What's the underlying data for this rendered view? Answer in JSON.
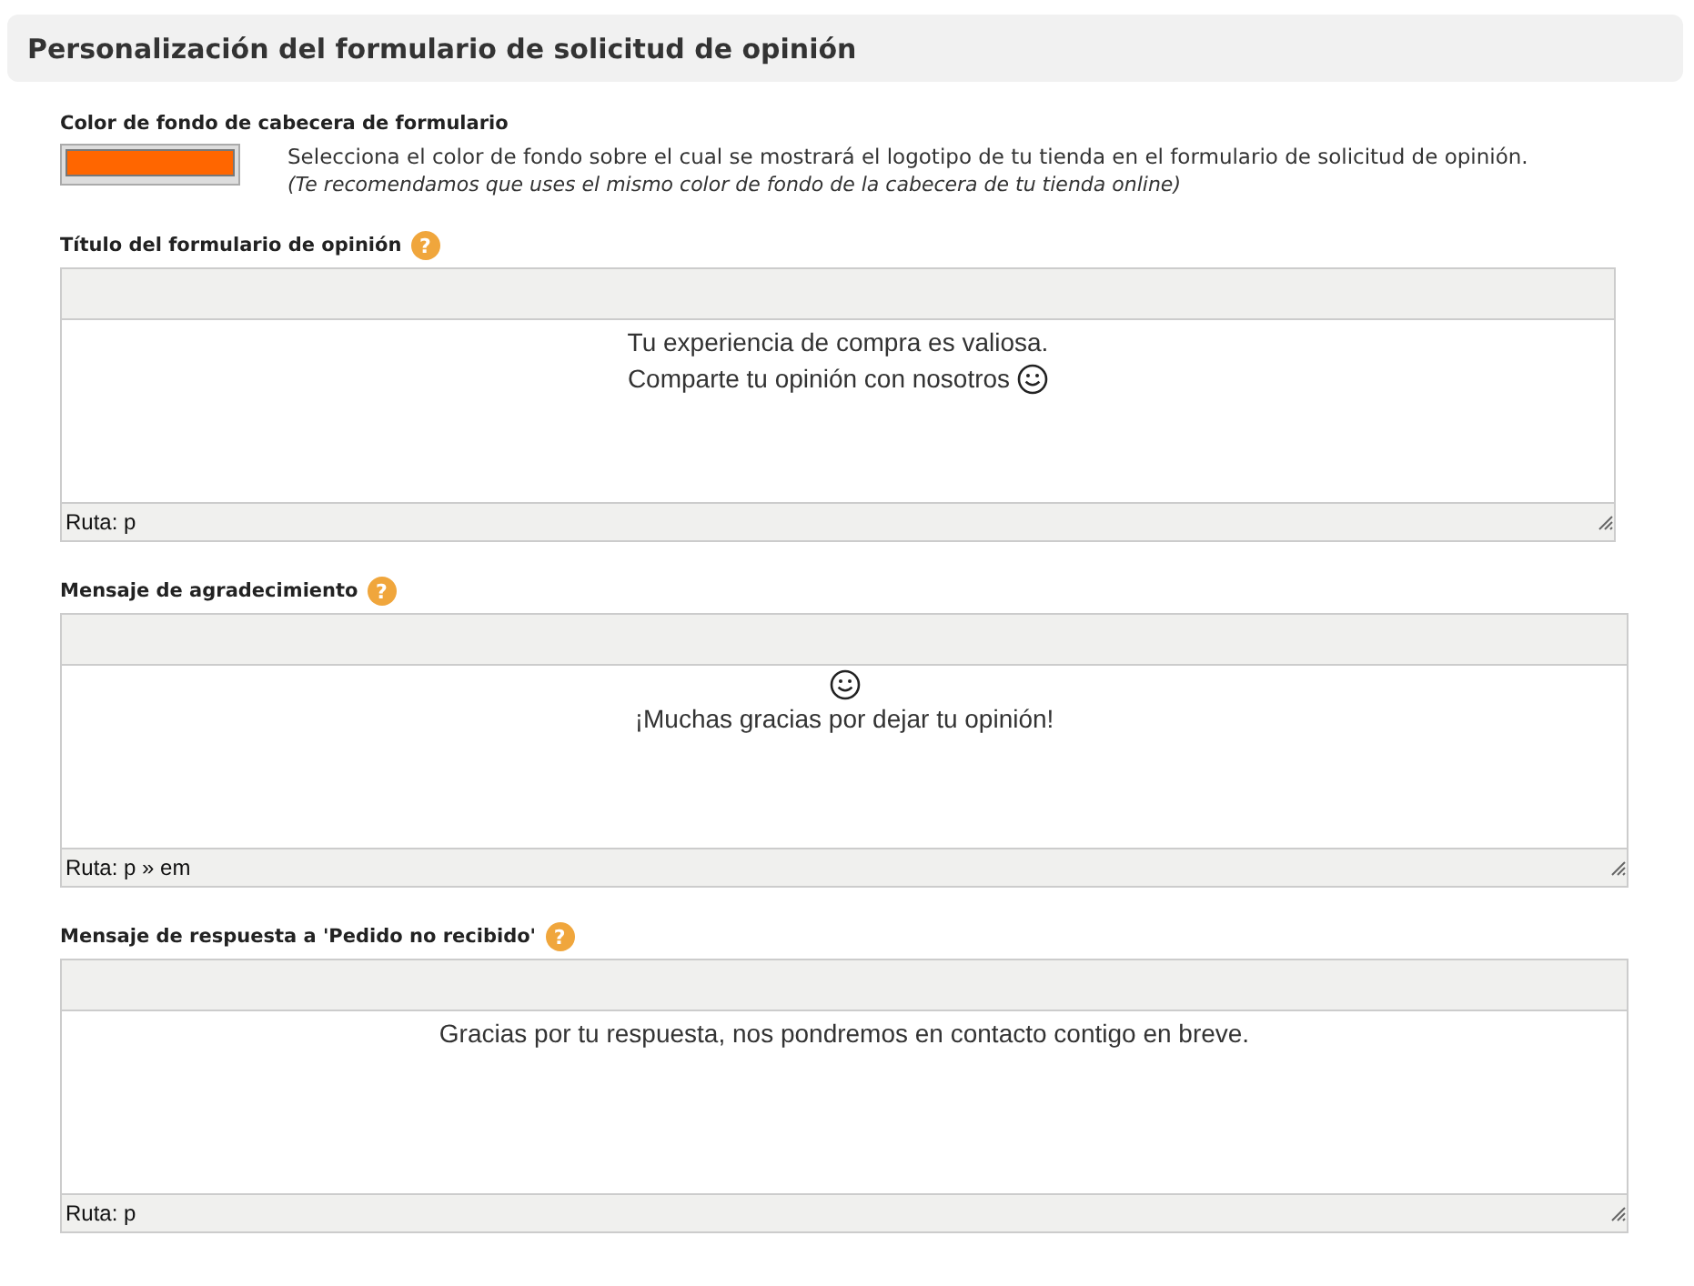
{
  "header": {
    "title": "Personalización del formulario de solicitud de opinión"
  },
  "color_setting": {
    "label": "Color de fondo de cabecera de formulario",
    "color": "#ff6600",
    "description": "Selecciona el color de fondo sobre el cual se mostrará el logotipo de tu tienda en el formulario de solicitud de opinión.",
    "note": "(Te recomendamos que uses el mismo color de fondo de la cabecera de tu tienda online)"
  },
  "editors": [
    {
      "label": "Título del formulario de opinión",
      "help": "?",
      "lines": [
        {
          "text": "Tu experiencia de compra es valiosa.",
          "smiley": false
        },
        {
          "text": "Comparte tu opinión con nosotros",
          "smiley": true
        }
      ],
      "path": "Ruta: p"
    },
    {
      "label": "Mensaje de agradecimiento",
      "help": "?",
      "lines": [
        {
          "smiley": true
        },
        {
          "text": "¡Muchas gracias por dejar tu opinión!",
          "smiley": false
        }
      ],
      "path": "Ruta: p » em"
    },
    {
      "label": "Mensaje de respuesta a 'Pedido no recibido'",
      "help": "?",
      "lines": [
        {
          "text": "Gracias por tu respuesta, nos pondremos en contacto contigo en breve.",
          "smiley": false
        }
      ],
      "path": "Ruta: p"
    }
  ]
}
